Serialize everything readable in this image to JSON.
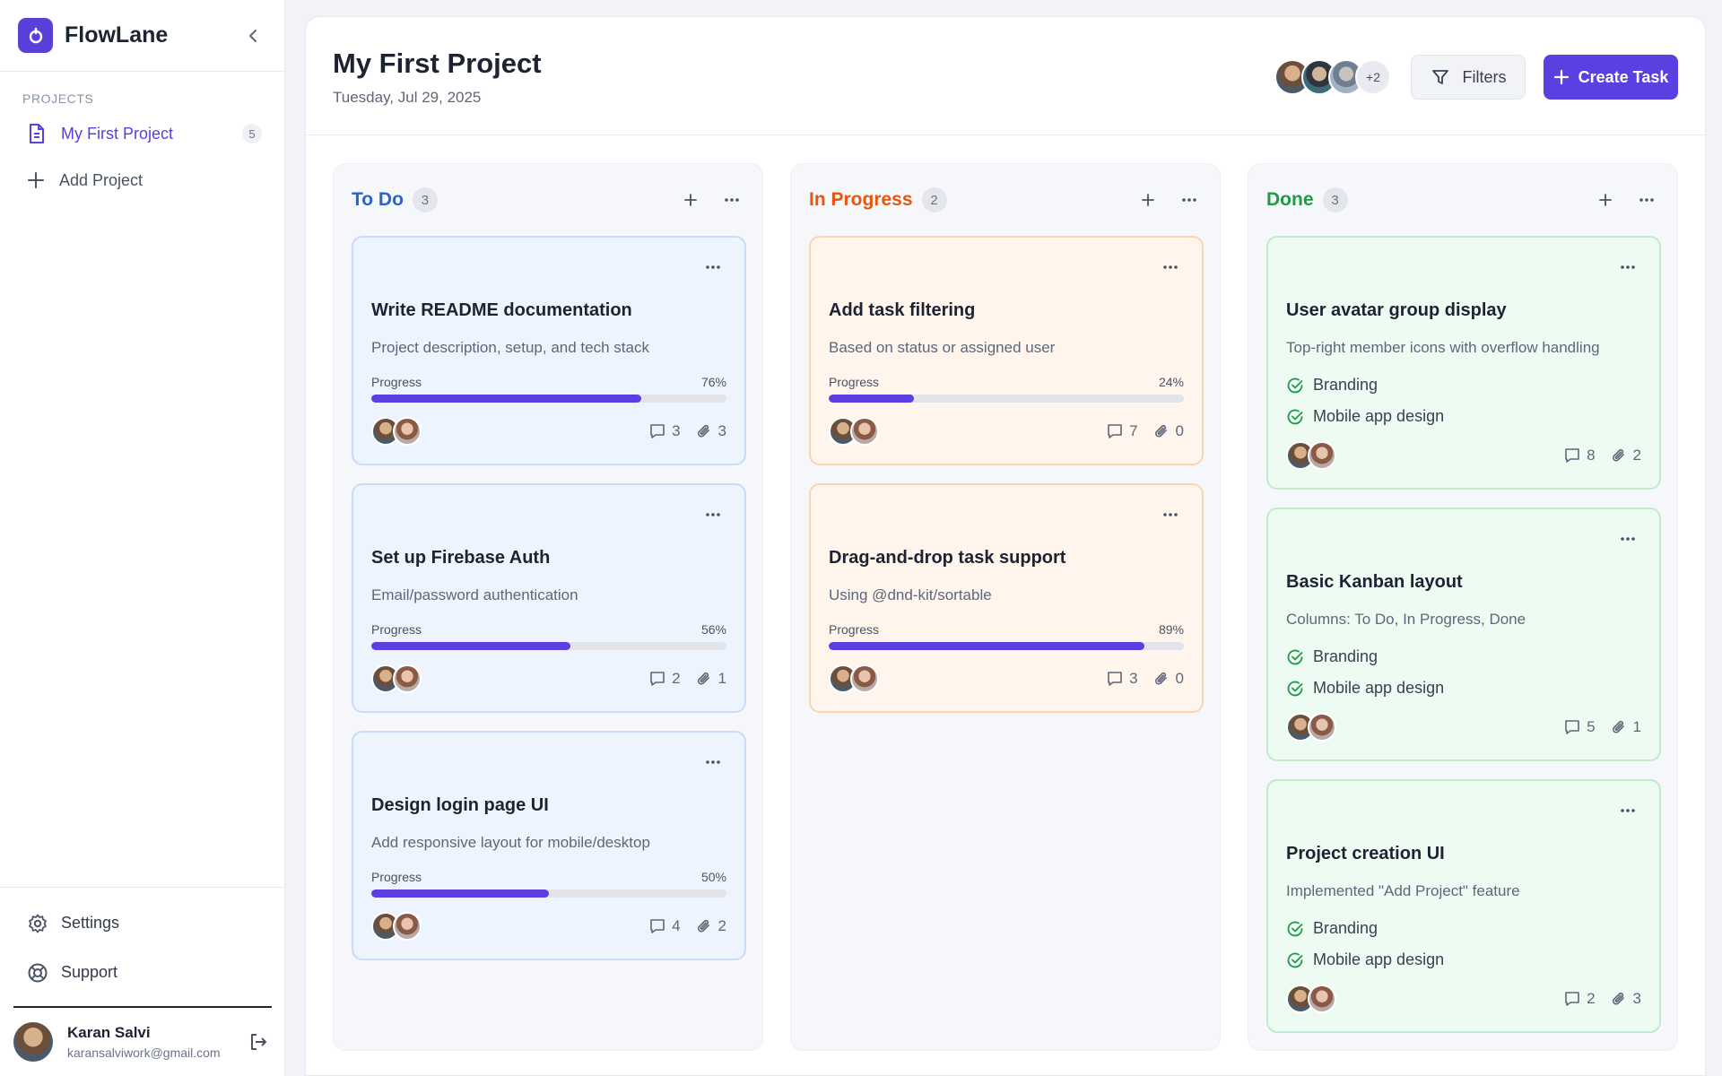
{
  "app": {
    "name": "FlowLane"
  },
  "sidebar": {
    "section_label": "PROJECTS",
    "projects": [
      {
        "label": "My First Project",
        "count": "5"
      }
    ],
    "add_project": "Add Project",
    "settings": "Settings",
    "support": "Support",
    "user": {
      "name": "Karan Salvi",
      "email": "karansalviwork@gmail.com"
    }
  },
  "header": {
    "title": "My First Project",
    "date": "Tuesday, Jul 29, 2025",
    "members_more": "+2",
    "filters_label": "Filters",
    "create_label": "Create Task"
  },
  "colors": {
    "accent": "#5b3fe0",
    "todo": "#2a63c9",
    "inprogress": "#e2580e",
    "done": "#1f9a4a"
  },
  "columns": [
    {
      "title": "To Do",
      "count": "3",
      "cards": [
        {
          "title": "Write README documentation",
          "desc": "Project description, setup, and tech stack",
          "progress_label": "Progress",
          "progress": 76,
          "progress_text": "76%",
          "comments": "3",
          "attachments": "3"
        },
        {
          "title": "Set up Firebase Auth",
          "desc": "Email/password authentication",
          "progress_label": "Progress",
          "progress": 56,
          "progress_text": "56%",
          "comments": "2",
          "attachments": "1"
        },
        {
          "title": "Design login page UI",
          "desc": "Add responsive layout for mobile/desktop",
          "progress_label": "Progress",
          "progress": 50,
          "progress_text": "50%",
          "comments": "4",
          "attachments": "2"
        }
      ]
    },
    {
      "title": "In Progress",
      "count": "2",
      "cards": [
        {
          "title": "Add task filtering",
          "desc": "Based on status or assigned user",
          "progress_label": "Progress",
          "progress": 24,
          "progress_text": "24%",
          "comments": "7",
          "attachments": "0"
        },
        {
          "title": "Drag-and-drop task support",
          "desc": "Using @dnd-kit/sortable",
          "progress_label": "Progress",
          "progress": 89,
          "progress_text": "89%",
          "comments": "3",
          "attachments": "0"
        }
      ]
    },
    {
      "title": "Done",
      "count": "3",
      "cards": [
        {
          "title": "User avatar group display",
          "desc": "Top-right member icons with overflow handling",
          "tags": [
            "Branding",
            "Mobile app design"
          ],
          "comments": "8",
          "attachments": "2"
        },
        {
          "title": "Basic Kanban layout",
          "desc": "Columns: To Do, In Progress, Done",
          "tags": [
            "Branding",
            "Mobile app design"
          ],
          "comments": "5",
          "attachments": "1"
        },
        {
          "title": "Project creation UI",
          "desc": "Implemented \"Add Project\" feature",
          "tags": [
            "Branding",
            "Mobile app design"
          ],
          "comments": "2",
          "attachments": "3"
        }
      ]
    }
  ]
}
